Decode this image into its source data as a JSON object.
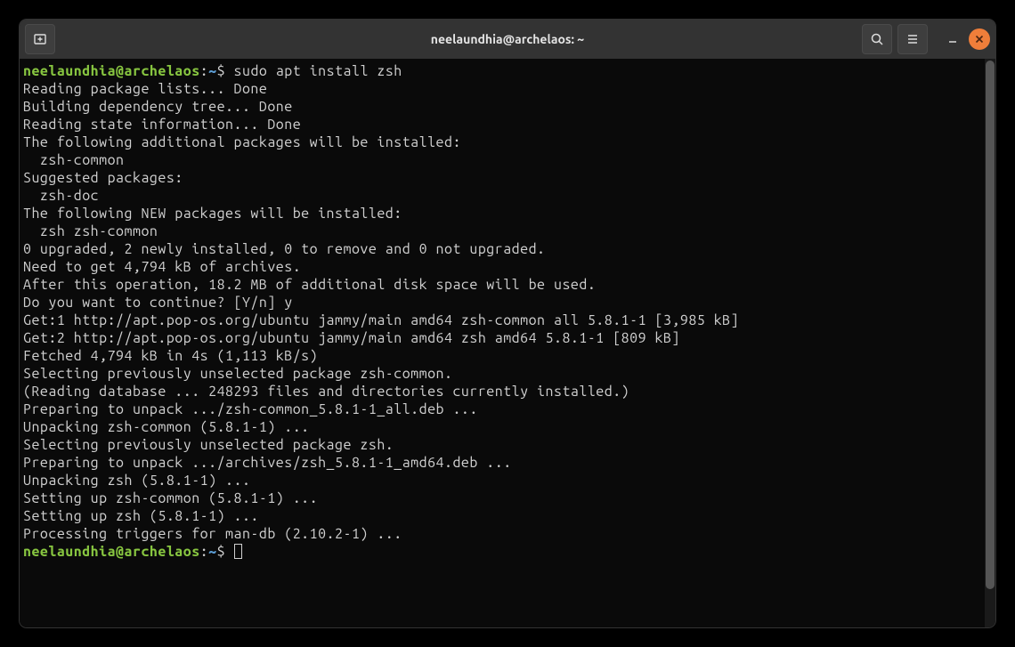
{
  "titlebar": {
    "title": "neelaundhia@archelaos: ~"
  },
  "prompt": {
    "user_host": "neelaundhia@archelaos",
    "colon": ":",
    "path": "~",
    "dollar": "$"
  },
  "command": "sudo apt install zsh",
  "output_lines": [
    "Reading package lists... Done",
    "Building dependency tree... Done",
    "Reading state information... Done",
    "The following additional packages will be installed:",
    "  zsh-common",
    "Suggested packages:",
    "  zsh-doc",
    "The following NEW packages will be installed:",
    "  zsh zsh-common",
    "0 upgraded, 2 newly installed, 0 to remove and 0 not upgraded.",
    "Need to get 4,794 kB of archives.",
    "After this operation, 18.2 MB of additional disk space will be used.",
    "Do you want to continue? [Y/n] y",
    "Get:1 http://apt.pop-os.org/ubuntu jammy/main amd64 zsh-common all 5.8.1-1 [3,985 kB]",
    "Get:2 http://apt.pop-os.org/ubuntu jammy/main amd64 zsh amd64 5.8.1-1 [809 kB]",
    "Fetched 4,794 kB in 4s (1,113 kB/s)",
    "Selecting previously unselected package zsh-common.",
    "(Reading database ... 248293 files and directories currently installed.)",
    "Preparing to unpack .../zsh-common_5.8.1-1_all.deb ...",
    "Unpacking zsh-common (5.8.1-1) ...",
    "Selecting previously unselected package zsh.",
    "Preparing to unpack .../archives/zsh_5.8.1-1_amd64.deb ...",
    "Unpacking zsh (5.8.1-1) ...",
    "Setting up zsh-common (5.8.1-1) ...",
    "Setting up zsh (5.8.1-1) ...",
    "Processing triggers for man-db (2.10.2-1) ..."
  ]
}
